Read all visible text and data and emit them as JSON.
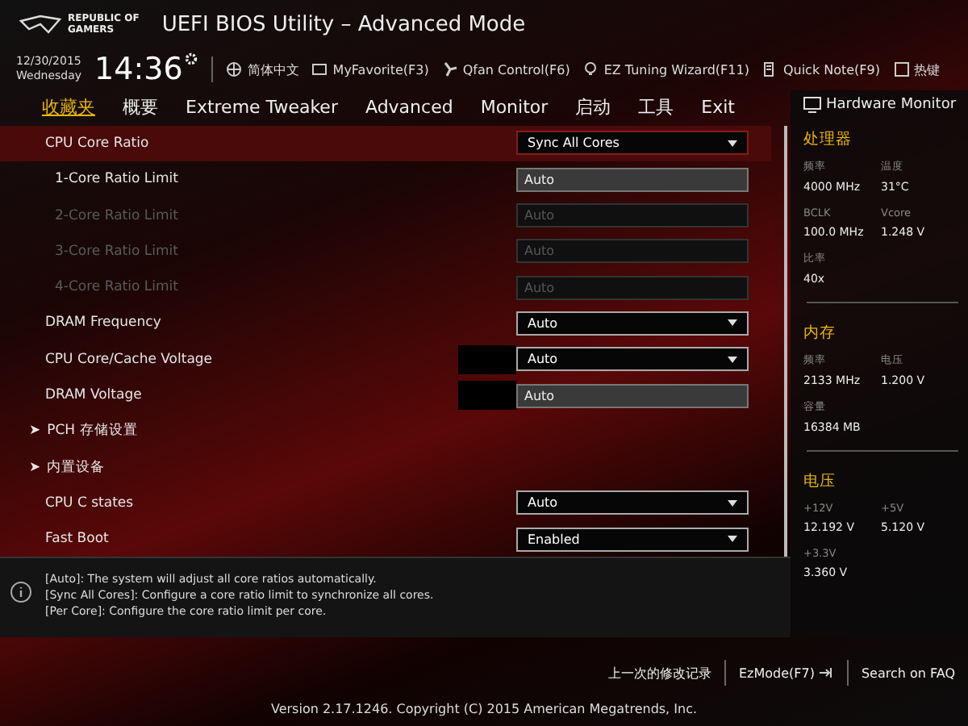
{
  "brand": {
    "line_1": "REPUBLIC OF",
    "line_2": "GAMERS"
  },
  "window": {
    "title": "UEFI BIOS Utility – Advanced Mode"
  },
  "clock": {
    "date": "12/30/2015",
    "weekday": "Wednesday",
    "time": "14:36"
  },
  "toolbar": [
    {
      "label": "简体中文"
    },
    {
      "label": "MyFavorite(F3)"
    },
    {
      "label": "Qfan Control(F6)"
    },
    {
      "label": "EZ Tuning Wizard(F11)"
    },
    {
      "label": "Quick Note(F9)"
    },
    {
      "label": "热键"
    }
  ],
  "tabs": [
    {
      "label": "收藏夹",
      "selected": true
    },
    {
      "label": "概要",
      "selected": false
    },
    {
      "label": "Extreme Tweaker",
      "selected": false
    },
    {
      "label": "Advanced",
      "selected": false
    },
    {
      "label": "Monitor",
      "selected": false
    },
    {
      "label": "启动",
      "selected": false
    },
    {
      "label": "工具",
      "selected": false
    },
    {
      "label": "Exit",
      "selected": false
    }
  ],
  "settings": [
    {
      "kind": "select",
      "label": "CPU Core Ratio",
      "value": "Sync All Cores",
      "selected": true,
      "disabled": false,
      "indent": false,
      "reading_box": false
    },
    {
      "kind": "field",
      "label": "1-Core Ratio Limit",
      "value": "Auto",
      "selected": false,
      "disabled": false,
      "indent": true,
      "reading_box": false
    },
    {
      "kind": "field",
      "label": "2-Core Ratio Limit",
      "value": "Auto",
      "selected": false,
      "disabled": true,
      "indent": true,
      "reading_box": false
    },
    {
      "kind": "field",
      "label": "3-Core Ratio Limit",
      "value": "Auto",
      "selected": false,
      "disabled": true,
      "indent": true,
      "reading_box": false
    },
    {
      "kind": "field",
      "label": "4-Core Ratio Limit",
      "value": "Auto",
      "selected": false,
      "disabled": true,
      "indent": true,
      "reading_box": false
    },
    {
      "kind": "select",
      "label": "DRAM Frequency",
      "value": "Auto",
      "selected": false,
      "disabled": false,
      "indent": false,
      "reading_box": false
    },
    {
      "kind": "select",
      "label": "CPU Core/Cache Voltage",
      "value": "Auto",
      "selected": false,
      "disabled": false,
      "indent": false,
      "reading_box": true
    },
    {
      "kind": "field",
      "label": "DRAM Voltage",
      "value": "Auto",
      "selected": false,
      "disabled": false,
      "indent": false,
      "reading_box": true
    },
    {
      "kind": "submenu",
      "label": "PCH 存储设置",
      "marker": "➤"
    },
    {
      "kind": "submenu",
      "label": "内置设备",
      "marker": "➤"
    },
    {
      "kind": "select",
      "label": "CPU C states",
      "value": "Auto",
      "selected": false,
      "disabled": false,
      "indent": false,
      "reading_box": false
    },
    {
      "kind": "select",
      "label": "Fast Boot",
      "value": "Enabled",
      "selected": false,
      "disabled": false,
      "indent": false,
      "reading_box": false
    }
  ],
  "help": {
    "lines": [
      "[Auto]: The system will adjust all core ratios automatically.",
      "[Sync All Cores]: Configure a core ratio limit to synchronize all cores.",
      "[Per Core]: Configure the core ratio limit per core."
    ]
  },
  "hardware_monitor": {
    "title": "Hardware Monitor",
    "sections": [
      {
        "title": "处理器",
        "items": [
          {
            "label": "频率",
            "value": "4000 MHz"
          },
          {
            "label": "温度",
            "value": "31°C"
          },
          {
            "label": "BCLK",
            "value": "100.0 MHz"
          },
          {
            "label": "Vcore",
            "value": "1.248 V"
          },
          {
            "label": "比率",
            "value": "40x"
          }
        ]
      },
      {
        "title": "内存",
        "items": [
          {
            "label": "频率",
            "value": "2133 MHz"
          },
          {
            "label": "电压",
            "value": "1.200 V"
          },
          {
            "label": "容量",
            "value": "16384 MB"
          }
        ]
      },
      {
        "title": "电压",
        "items": [
          {
            "label": "+12V",
            "value": "12.192 V"
          },
          {
            "label": "+5V",
            "value": "5.120 V"
          },
          {
            "label": "+3.3V",
            "value": "3.360 V"
          }
        ]
      }
    ]
  },
  "footer": {
    "links": [
      {
        "label": "上一次的修改记录"
      },
      {
        "label": "EzMode(F7)"
      },
      {
        "label": "Search on FAQ"
      }
    ],
    "version": "Version 2.17.1246. Copyright (C) 2015 American Megatrends, Inc."
  }
}
